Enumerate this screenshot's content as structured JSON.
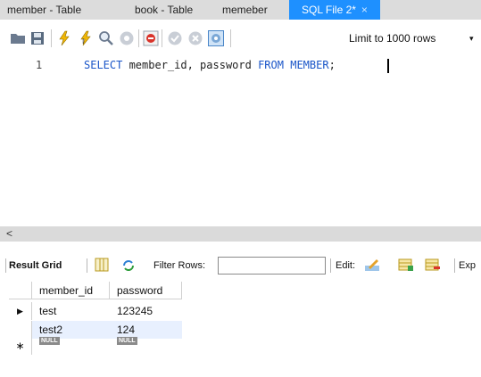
{
  "tabs": [
    {
      "label": "member - Table",
      "active": false
    },
    {
      "label": "book - Table",
      "active": false
    },
    {
      "label": "memeber",
      "active": false
    },
    {
      "label": "SQL File 2*",
      "active": true,
      "close": "×"
    }
  ],
  "toolbar": {
    "limit_label": "Limit to 1000 rows",
    "limit_arrow": "▾"
  },
  "editor": {
    "line_number": "1",
    "tokens": {
      "select": "SELECT",
      "cols": " member_id, password ",
      "from": "FROM",
      "space": " ",
      "table": "MEMBER",
      "semicolon": ";"
    }
  },
  "scrollbar": {
    "left_arrow": "<"
  },
  "results": {
    "result_grid_label": "Result Grid",
    "filter_rows_label": "Filter Rows:",
    "filter_value": "",
    "edit_label": "Edit:",
    "export_label": "Exp"
  },
  "grid": {
    "columns": [
      "member_id",
      "password"
    ],
    "rows": [
      {
        "indicator": "▶",
        "member_id": "test",
        "password": "123245",
        "selected": false
      },
      {
        "indicator": "",
        "member_id": "test2",
        "password": "124",
        "selected": true
      }
    ],
    "new_row": {
      "indicator": "∗",
      "member_id": "NULL",
      "password": "NULL"
    }
  },
  "colors": {
    "tab_active": "#1e90ff",
    "keyword": "#1a55c8",
    "selected_row": "#e8f0fe"
  }
}
